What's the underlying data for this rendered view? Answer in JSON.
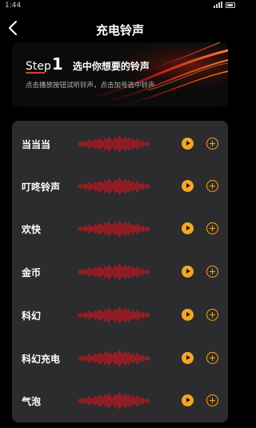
{
  "status": {
    "time": "1:44"
  },
  "nav": {
    "title": "充电铃声",
    "back_icon": "chevron-left-icon"
  },
  "banner": {
    "step_word": "Step",
    "step_number": "1",
    "heading": "选中你想要的铃声",
    "hint": "点击播放按钮试听铃声，点击加号选中铃声"
  },
  "colors": {
    "accent": "#f5a623",
    "wave": "#c8141e",
    "card": "#2c2c2e",
    "background": "#000000"
  },
  "ringtones": [
    {
      "name": "当当当"
    },
    {
      "name": "叮咚铃声"
    },
    {
      "name": "欢快"
    },
    {
      "name": "金币"
    },
    {
      "name": "科幻"
    },
    {
      "name": "科幻充电"
    },
    {
      "name": "气泡"
    }
  ]
}
